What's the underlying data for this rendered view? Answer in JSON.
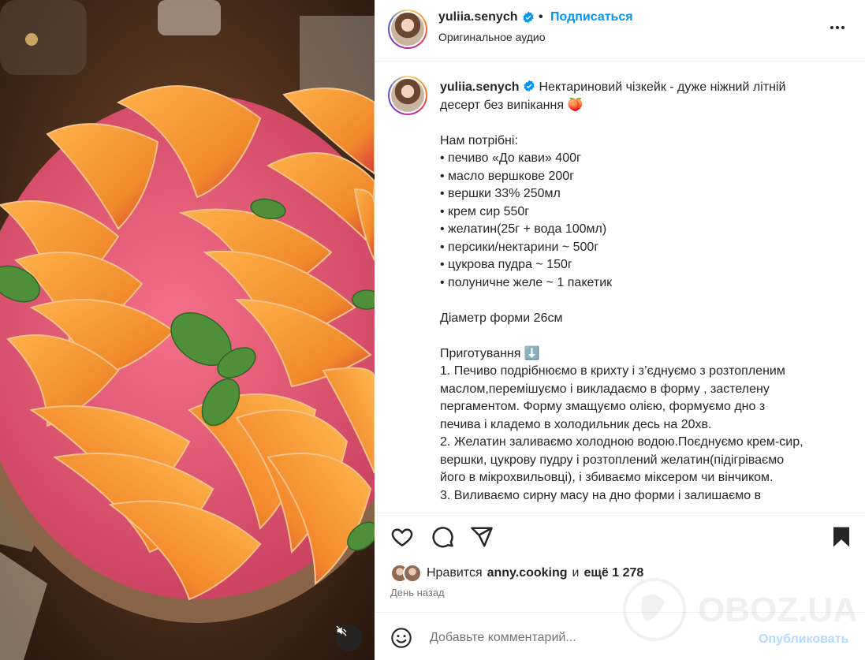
{
  "post": {
    "username": "yuliia.senych",
    "follow_label": "Подписаться",
    "separator": "•",
    "audio_label": "Оригинальное аудио"
  },
  "caption": {
    "username": "yuliia.senych",
    "lines": [
      "Нектариновий чізкейк - дуже ніжний літній",
      "десерт без випікання 🍑",
      "",
      "Нам потрібні:",
      "• печиво «До кави» 400г",
      "• масло вершкове 200г",
      "• вершки 33% 250мл",
      "• крем сир 550г",
      "• желатин(25г + вода 100мл)",
      "• персики/нектарини ~ 500г",
      "• цукрова пудра ~ 150г",
      "• полуничне желе ~ 1 пакетик",
      "",
      "Діаметр форми 26см",
      "",
      "Приготування ⬇️",
      "1. Печиво подрібнюємо в крихту і з’єднуємо з розтопленим",
      "маслом,перемішуємо і викладаємо в форму , застелену",
      "пергаментом. Форму змащуємо олією, формуємо дно з",
      "печива і кладемо в холодильник десь на 20хв.",
      "2. Желатин заливаємо холодною водою.Поєднуємо крем-сир,",
      "вершки, цукрову пудру і розтоплений желатин(підігріваємо",
      "його в мікрохвильовці), і збиваємо міксером чи вінчиком.",
      "3. Виливаємо сирну масу на дно форми і залишаємо в"
    ]
  },
  "likes": {
    "prefix": "Нравится",
    "user": "anny.cooking",
    "middle": "и",
    "rest": "ещё 1 278"
  },
  "timestamp": "День назад",
  "comment": {
    "placeholder": "Добавьте комментарий...",
    "post_label": "Опубликовать"
  },
  "watermark_text": "OBOZ.UA",
  "colors": {
    "accent": "#0095f6",
    "post_disabled": "#b3dbff",
    "verified": "#0095f6"
  },
  "icons": [
    "heart-icon",
    "comment-icon",
    "share-icon",
    "bookmark-icon",
    "more-icon",
    "emoji-icon",
    "mute-icon",
    "verified-icon"
  ]
}
